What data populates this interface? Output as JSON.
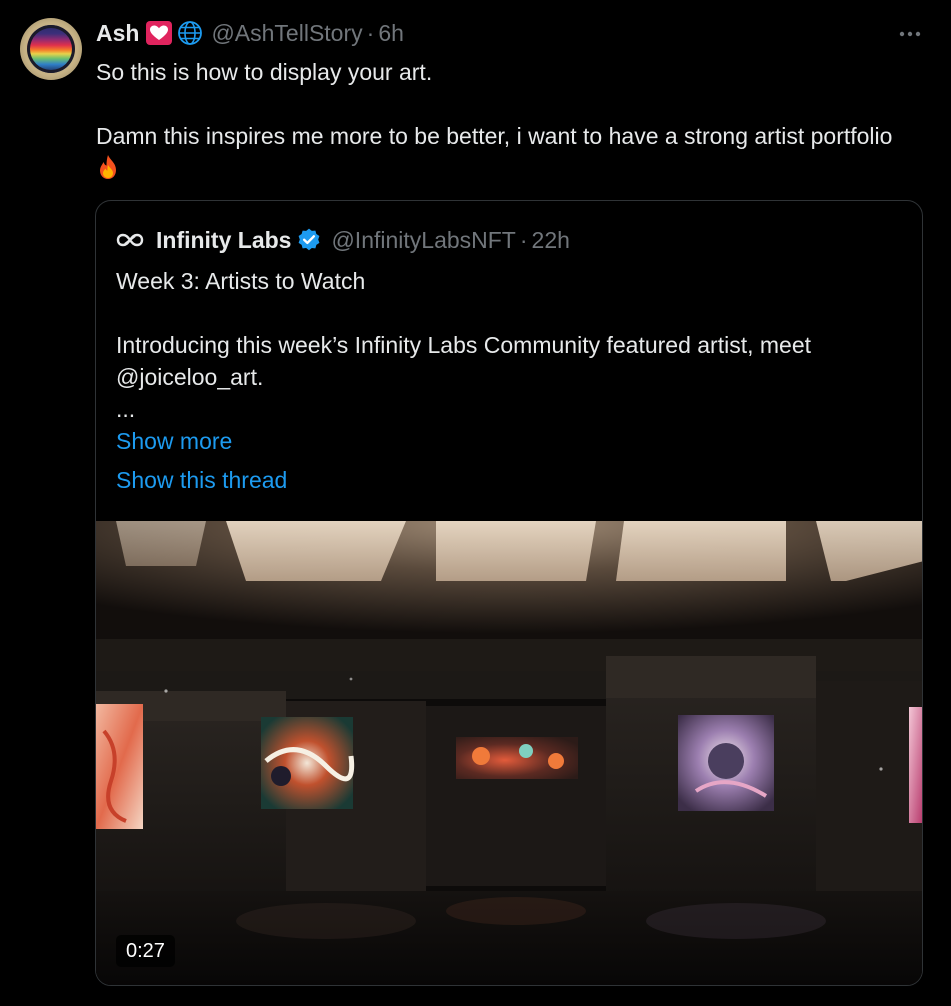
{
  "tweet": {
    "author_name": "Ash",
    "author_handle": "@AshTellStory",
    "separator": "·",
    "time": "6h",
    "text_line1": "So this is how to display your art.",
    "text_line2": "Damn this inspires me more to be better, i want to have a strong artist portfolio",
    "icons": {
      "avatar": "avatar",
      "badge": "heart-icon",
      "globe": "globe-icon",
      "more": "more-icon",
      "emoji": "fire-icon"
    }
  },
  "quote": {
    "author_name": "Infinity Labs",
    "author_handle": "@InfinityLabsNFT",
    "separator": "·",
    "time": "22h",
    "text_line1": "Week 3: Artists to Watch",
    "text_line2": "Introducing this week’s Infinity Labs Community featured artist, meet @joiceloo_art.",
    "text_line3": "...",
    "show_more": "Show more",
    "show_thread": "Show this thread",
    "icons": {
      "logo": "infinity-logo-icon",
      "verified": "verified-icon"
    }
  },
  "video": {
    "duration": "0:27"
  },
  "colors": {
    "background": "#000000",
    "text": "#e7e9ea",
    "secondary": "#71767b",
    "link": "#1d9bf0",
    "border": "#2f3336"
  }
}
